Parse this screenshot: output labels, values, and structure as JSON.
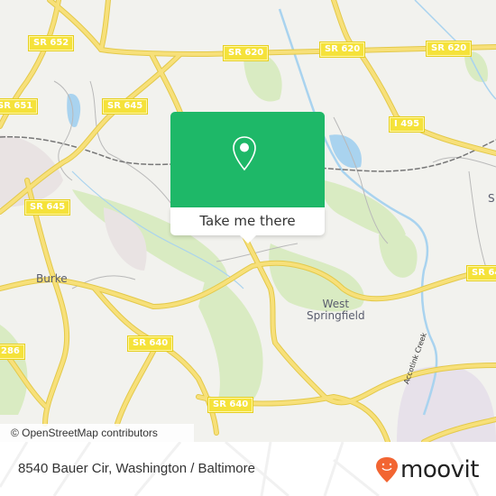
{
  "map": {
    "road_labels": [
      {
        "id": "sr652",
        "text": "SR 652"
      },
      {
        "id": "sr620-a",
        "text": "SR 620"
      },
      {
        "id": "sr620-b",
        "text": "SR 620"
      },
      {
        "id": "sr620-c",
        "text": "SR 620"
      },
      {
        "id": "sr651",
        "text": "SR 651"
      },
      {
        "id": "sr645-a",
        "text": "SR 645"
      },
      {
        "id": "i495",
        "text": "I 495"
      },
      {
        "id": "sr645-b",
        "text": "SR 645"
      },
      {
        "id": "sr64x",
        "text": "SR 64"
      },
      {
        "id": "sr286",
        "text": "286"
      },
      {
        "id": "sr640-a",
        "text": "SR 640"
      },
      {
        "id": "sr640-b",
        "text": "SR 640"
      }
    ],
    "place_labels": {
      "burke": "Burke",
      "west_springfield_line1": "West",
      "west_springfield_line2": "Springfield",
      "partial_s": "S"
    },
    "waterway_label": "Accotink Creek",
    "attribution": "© OpenStreetMap contributors",
    "colors": {
      "background": "#f2f2ee",
      "road": "#f7e07a",
      "shield": "#f5e23a",
      "park": "#d9ebc2",
      "water": "#a9d3ef",
      "rail": "#777777"
    }
  },
  "popup": {
    "icon": "location-pin-icon",
    "button_label": "Take me there",
    "color": "#1eb868"
  },
  "footer": {
    "address": "8540 Bauer Cir, Washington / Baltimore",
    "brand": "moovit",
    "brand_color": "#f26532"
  }
}
